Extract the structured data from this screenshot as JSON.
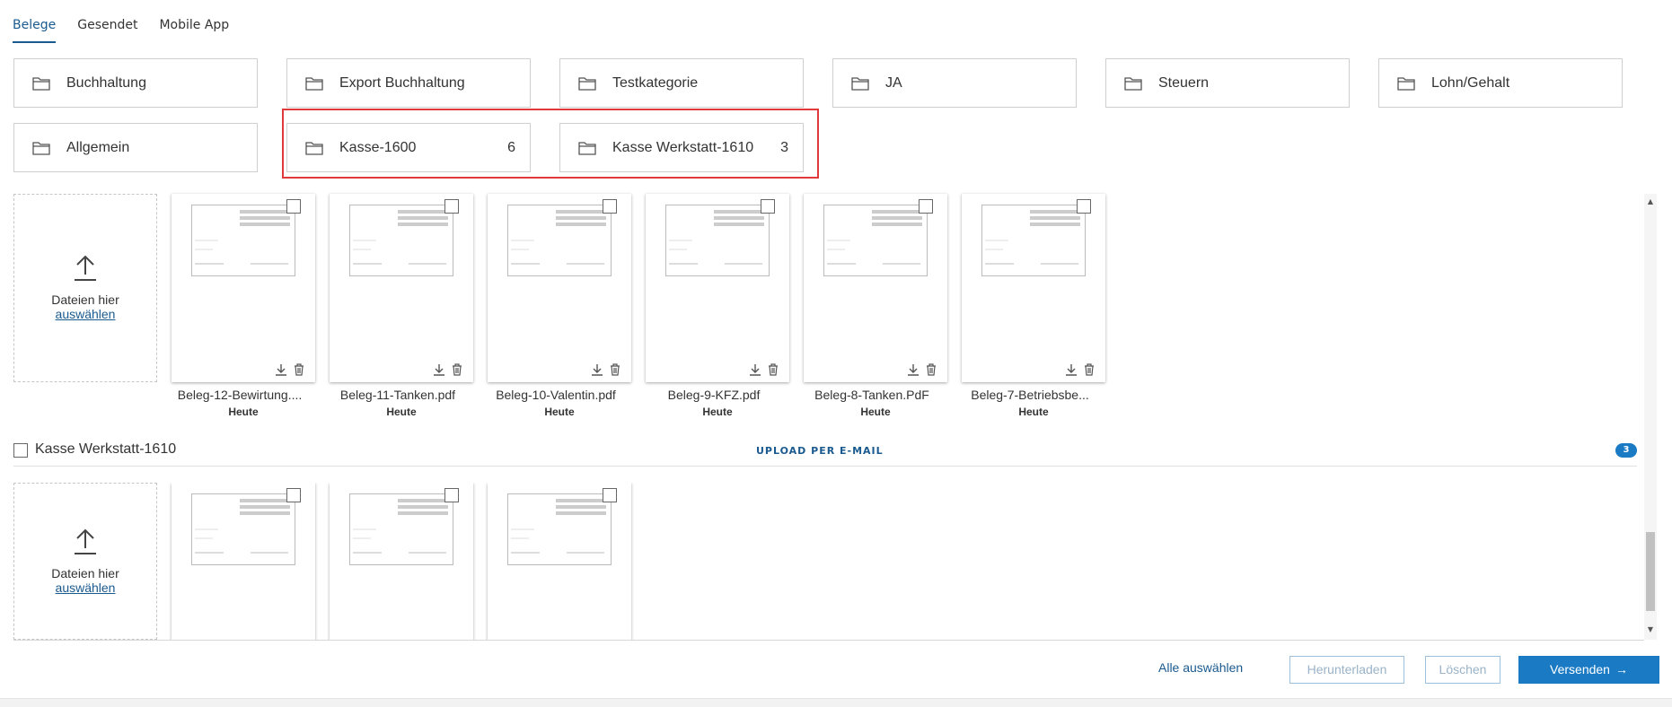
{
  "tabs": [
    {
      "label": "Belege",
      "active": true
    },
    {
      "label": "Gesendet",
      "active": false
    },
    {
      "label": "Mobile App",
      "active": false
    }
  ],
  "folders": [
    {
      "name": "Buchhaltung",
      "count": ""
    },
    {
      "name": "Export Buchhaltung",
      "count": ""
    },
    {
      "name": "Testkategorie",
      "count": ""
    },
    {
      "name": "JA",
      "count": ""
    },
    {
      "name": "Steuern",
      "count": ""
    },
    {
      "name": "Lohn/Gehalt",
      "count": ""
    },
    {
      "name": "Allgemein",
      "count": ""
    },
    {
      "name": "Kasse-1600",
      "count": "6"
    },
    {
      "name": "Kasse Werkstatt-1610",
      "count": "3"
    }
  ],
  "upload": {
    "text": "Dateien hier",
    "link": "auswählen"
  },
  "section1": {
    "documents": [
      {
        "name": "Beleg-12-Bewirtung....",
        "date": "Heute"
      },
      {
        "name": "Beleg-11-Tanken.pdf",
        "date": "Heute"
      },
      {
        "name": "Beleg-10-Valentin.pdf",
        "date": "Heute"
      },
      {
        "name": "Beleg-9-KFZ.pdf",
        "date": "Heute"
      },
      {
        "name": "Beleg-8-Tanken.PdF",
        "date": "Heute"
      },
      {
        "name": "Beleg-7-Betriebsbe...",
        "date": "Heute"
      }
    ]
  },
  "section2": {
    "title": "Kasse Werkstatt-1610",
    "upload_email": "UPLOAD PER E-MAIL",
    "count": "3",
    "documents": [
      {},
      {},
      {}
    ]
  },
  "actions": {
    "select_all": "Alle auswählen",
    "download": "Herunterladen",
    "delete": "Löschen",
    "send": "Versenden"
  },
  "colors": {
    "accent": "#1a5a8f",
    "primary_button": "#1a7bc4",
    "highlight_border": "#e03a3a"
  }
}
